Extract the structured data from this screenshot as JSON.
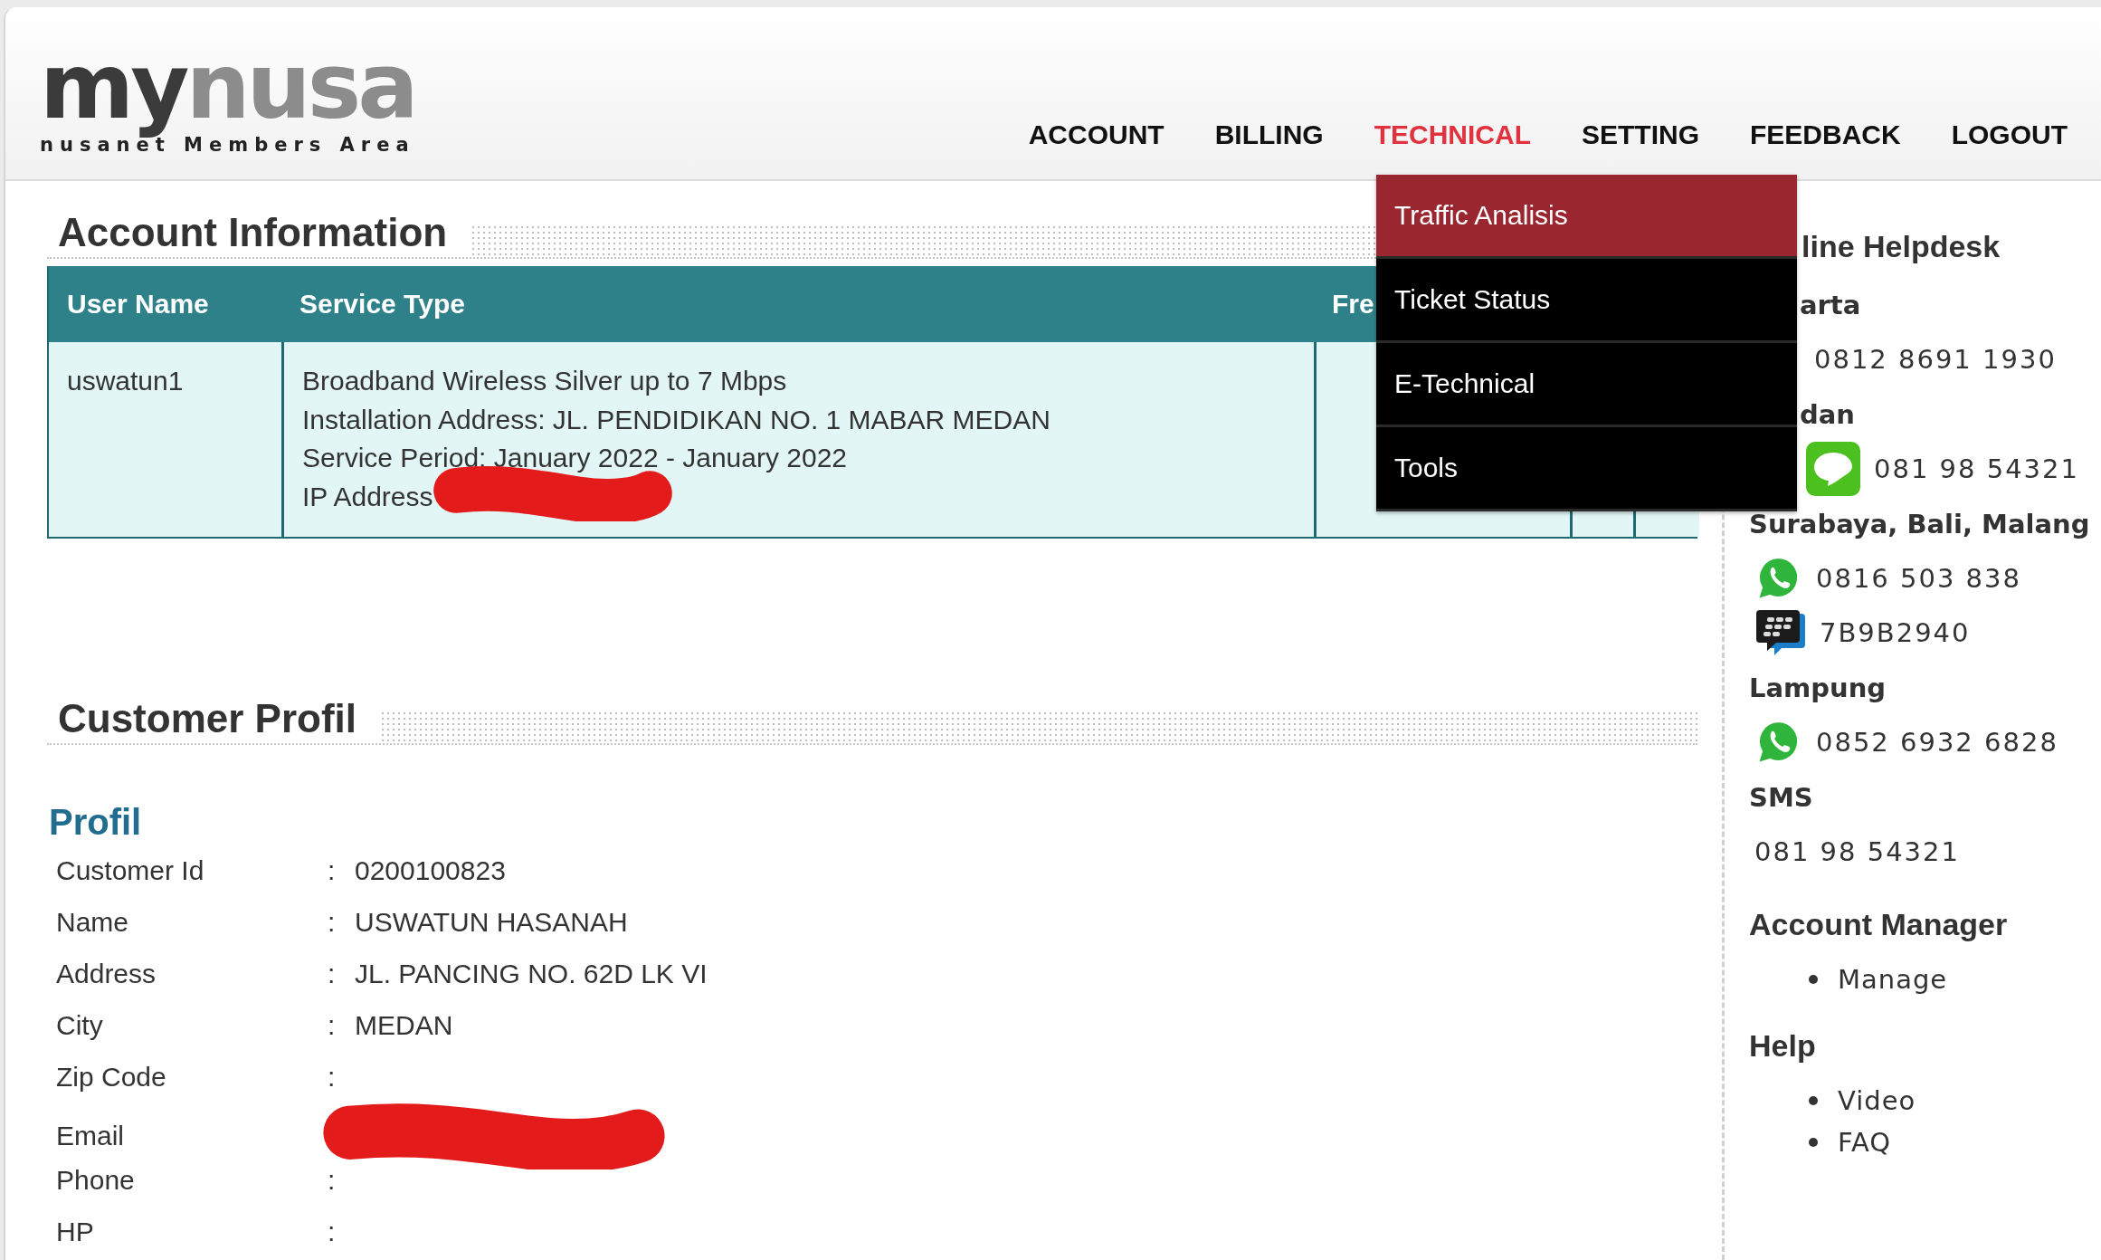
{
  "logo": {
    "part_1": "my",
    "part_2": "nusa",
    "tagline": "nusanet Members Area"
  },
  "nav": [
    {
      "label": "ACCOUNT",
      "selected": false
    },
    {
      "label": "BILLING",
      "selected": false
    },
    {
      "label": "TECHNICAL",
      "selected": true
    },
    {
      "label": "SETTING",
      "selected": false
    },
    {
      "label": "FEEDBACK",
      "selected": false
    },
    {
      "label": "LOGOUT",
      "selected": false
    }
  ],
  "dropdown": [
    {
      "label": "Traffic Analisis",
      "selected": true
    },
    {
      "label": "Ticket Status",
      "selected": false
    },
    {
      "label": "E-Technical",
      "selected": false
    },
    {
      "label": "Tools",
      "selected": false
    }
  ],
  "account_information": {
    "title": "Account Information",
    "table": {
      "columns": [
        "User Name",
        "Service Type",
        "Fre"
      ],
      "rows": [
        {
          "user_name": "uswatun1",
          "service_lines": [
            {
              "text": "Broadband Wireless Silver up to 7 Mbps",
              "redacted": false
            },
            {
              "text": "Installation Address: JL. PENDIDIKAN NO. 1 MABAR MEDAN",
              "redacted": false
            },
            {
              "text": "Service Period: January 2022 - January 2022",
              "redacted": false
            },
            {
              "text": "IP Address",
              "redacted": true
            }
          ]
        }
      ]
    }
  },
  "customer_profil": {
    "title": "Customer Profil",
    "subtitle": "Profil",
    "fields": [
      {
        "label": "Customer Id",
        "separator": ":",
        "value": "0200100823",
        "redacted": false
      },
      {
        "label": "Name",
        "separator": ":",
        "value": "USWATUN HASANAH",
        "redacted": false
      },
      {
        "label": "Address",
        "separator": ":",
        "value": "JL. PANCING NO. 62D LK VI",
        "redacted": false
      },
      {
        "label": "City",
        "separator": ":",
        "value": "MEDAN",
        "redacted": false
      },
      {
        "label": "Zip Code",
        "separator": ":",
        "redacted": false
      },
      {
        "label": "Email",
        "redacted": true
      },
      {
        "label": "Phone",
        "separator": ":",
        "redacted": false
      },
      {
        "label": "HP",
        "separator": ":",
        "redacted": false
      }
    ]
  },
  "sidebar": {
    "helpdesk_title": "line Helpdesk",
    "helpdesk_title_covered": true,
    "entries": [
      {
        "kind": "city",
        "text": "arta",
        "covered": true
      },
      {
        "kind": "contact",
        "text": "0812 8691 1930",
        "covered": true
      },
      {
        "kind": "city",
        "text": "dan",
        "covered": true
      },
      {
        "kind": "line_contact",
        "text": "081 98 54321",
        "covered": true
      },
      {
        "kind": "city",
        "text": "Surabaya, Bali, Malang",
        "covered": false
      },
      {
        "kind": "whatsapp_contact",
        "text": "0816 503 838",
        "covered": false
      },
      {
        "kind": "bbm_contact",
        "text": "7B9B2940",
        "covered": false
      },
      {
        "kind": "city",
        "text": "Lampung",
        "covered": false
      },
      {
        "kind": "whatsapp_contact",
        "text": "0852 6932 6828",
        "covered": false
      },
      {
        "kind": "city",
        "text": "SMS",
        "covered": false
      },
      {
        "kind": "contact",
        "text": "081 98 54321",
        "covered": false
      }
    ],
    "sections": [
      {
        "title": "Account Manager",
        "links": [
          "Manage"
        ]
      },
      {
        "title": "Help",
        "links": [
          "Video",
          "FAQ"
        ]
      }
    ]
  }
}
